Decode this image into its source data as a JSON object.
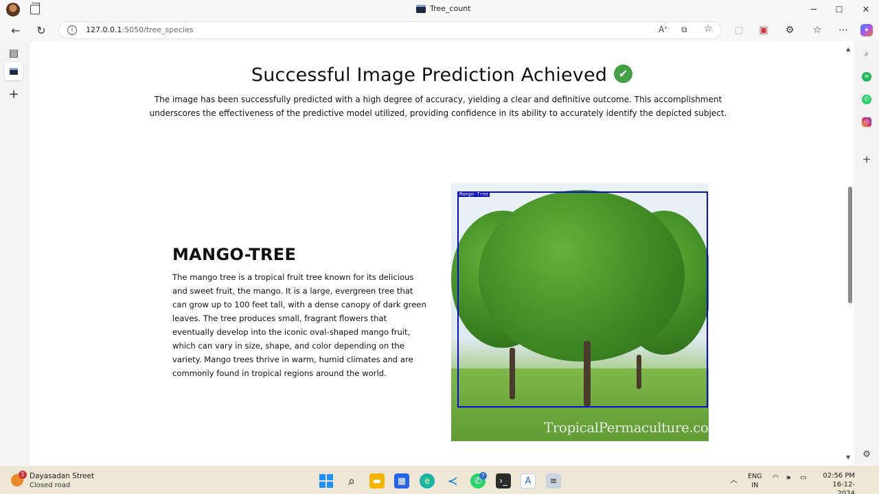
{
  "window": {
    "title": "Tree_count",
    "controls": {
      "minimize": "─",
      "maximize": "☐",
      "close": "✕"
    }
  },
  "browser": {
    "url_host": "127.0.0.1",
    "url_path": ":5050/tree_species",
    "nav_icons": [
      "back-icon",
      "refresh-icon"
    ],
    "address_icons": [
      "read-aloud-icon",
      "immersive-reader-icon",
      "favorite-star-icon"
    ],
    "toolbar_icons": [
      "split-screen-icon",
      "pdf-extension-icon",
      "extensions-icon",
      "favorites-icon",
      "more-menu-icon",
      "copilot-icon"
    ]
  },
  "page": {
    "heading": "Successful Image Prediction Achieved",
    "intro": "The image has been successfully predicted with a high degree of accuracy, yielding a clear and definitive outcome. This accomplishment underscores the effectiveness of the predictive model utilized, providing confidence in its ability to accurately identify the depicted subject.",
    "species_name": "MANGO-TREE",
    "species_description": "The mango tree is a tropical fruit tree known for its delicious and sweet fruit, the mango. It is a large, evergreen tree that can grow up to 100 feet tall, with a dense canopy of dark green leaves. The tree produces small, fragrant flowers that eventually develop into the iconic oval-shaped mango fruit, which can vary in size, shape, and color depending on the variety. Mango trees thrive in warm, humid climates and are commonly found in tropical regions around the world.",
    "image": {
      "bbox_label": "Mango-Tree",
      "watermark": "TropicalPermaculture.com",
      "bbox_color": "#0a0acf"
    }
  },
  "taskbar": {
    "weather_badge": "1",
    "weather_street": "Dayasadan Street",
    "weather_status": "Closed road",
    "whatsapp_badge": "7",
    "language_top": "ENG",
    "language_bottom": "IN",
    "time": "02:56 PM",
    "date": "16-12-2024"
  },
  "colors": {
    "success_check": "#43a047",
    "page_bg": "#ffffff",
    "taskbar_bg": "#efe7d6"
  }
}
